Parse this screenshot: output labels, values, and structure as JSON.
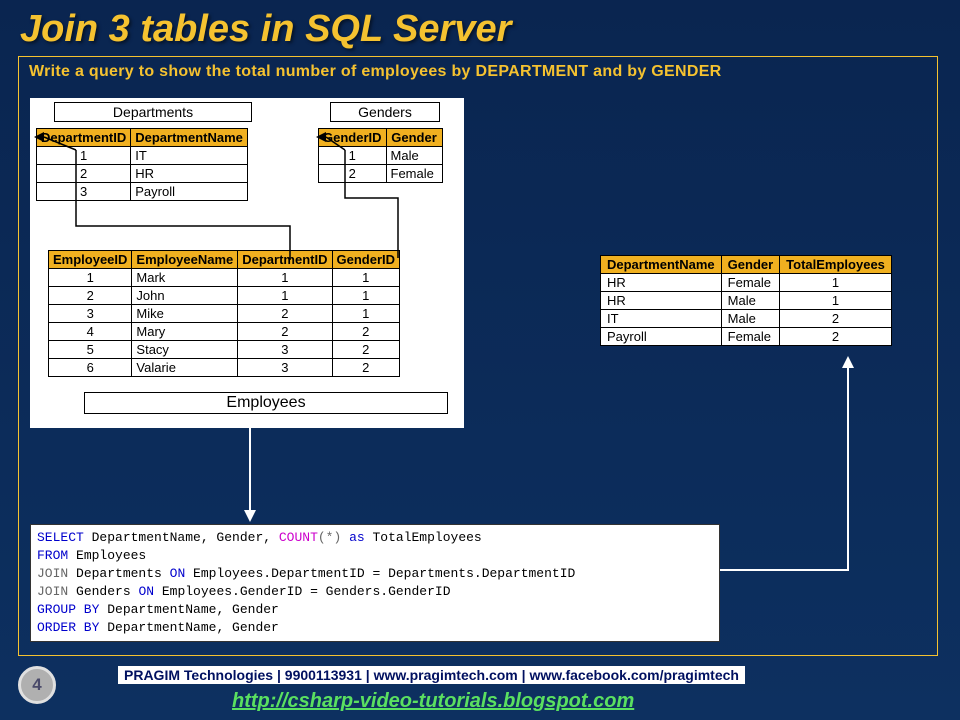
{
  "title": "Join 3 tables in SQL Server",
  "subtitle": "Write a query to show the total number of employees by DEPARTMENT and by GENDER",
  "departments": {
    "label": "Departments",
    "headers": [
      "DepartmentID",
      "DepartmentName"
    ],
    "rows": [
      [
        "1",
        "IT"
      ],
      [
        "2",
        "HR"
      ],
      [
        "3",
        "Payroll"
      ]
    ]
  },
  "genders": {
    "label": "Genders",
    "headers": [
      "GenderID",
      "Gender"
    ],
    "rows": [
      [
        "1",
        "Male"
      ],
      [
        "2",
        "Female"
      ]
    ]
  },
  "employees": {
    "label": "Employees",
    "headers": [
      "EmployeeID",
      "EmployeeName",
      "DepartmentID",
      "GenderID"
    ],
    "rows": [
      [
        "1",
        "Mark",
        "1",
        "1"
      ],
      [
        "2",
        "John",
        "1",
        "1"
      ],
      [
        "3",
        "Mike",
        "2",
        "1"
      ],
      [
        "4",
        "Mary",
        "2",
        "2"
      ],
      [
        "5",
        "Stacy",
        "3",
        "2"
      ],
      [
        "6",
        "Valarie",
        "3",
        "2"
      ]
    ]
  },
  "result": {
    "headers": [
      "DepartmentName",
      "Gender",
      "TotalEmployees"
    ],
    "rows": [
      [
        "HR",
        "Female",
        "1"
      ],
      [
        "HR",
        "Male",
        "1"
      ],
      [
        "IT",
        "Male",
        "2"
      ],
      [
        "Payroll",
        "Female",
        "2"
      ]
    ]
  },
  "sql": {
    "l1a": "SELECT",
    "l1b": " DepartmentName, Gender, ",
    "l1c": "COUNT",
    "l1d": "(*)",
    "l1e": " as ",
    "l1f": "TotalEmployees",
    "l2a": "FROM",
    "l2b": " Employees",
    "l3a": "JOIN",
    "l3b": " Departments ",
    "l3c": "ON",
    "l3d": " Employees.DepartmentID = Departments.DepartmentID",
    "l4a": "JOIN",
    "l4b": " Genders ",
    "l4c": "ON",
    "l4d": " Employees.GenderID = Genders.GenderID",
    "l5a": "GROUP BY",
    "l5b": " DepartmentName, Gender",
    "l6a": "ORDER BY",
    "l6b": " DepartmentName, Gender"
  },
  "page_number": "4",
  "footer_text": "PRAGIM Technologies | 9900113931 | www.pragimtech.com | www.facebook.com/pragimtech",
  "footer_link": "http://csharp-video-tutorials.blogspot.com"
}
